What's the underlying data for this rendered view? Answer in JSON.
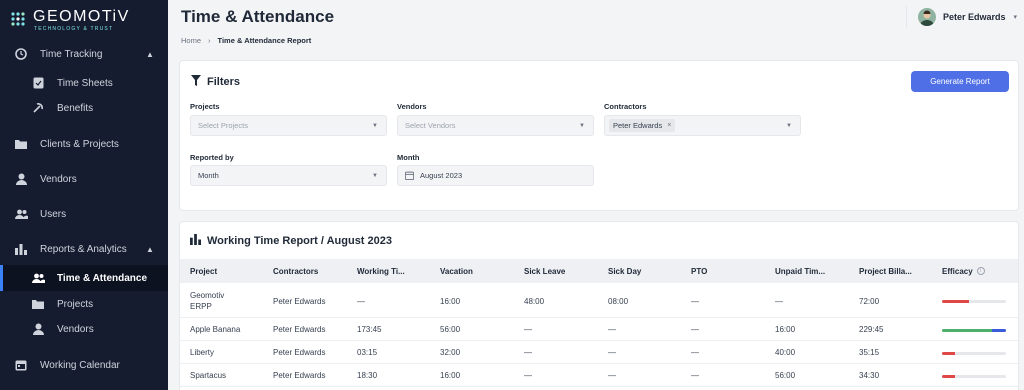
{
  "brand": {
    "name": "GEOMOTiV",
    "tagline": "TECHNOLOGY & TRUST"
  },
  "sidebar": {
    "items": [
      {
        "label": "Time Tracking",
        "icon": "clock-icon",
        "caret": "▲"
      },
      {
        "label": "Time Sheets",
        "icon": "timesheet-icon"
      },
      {
        "label": "Benefits",
        "icon": "benefits-icon"
      },
      {
        "label": "Clients & Projects",
        "icon": "folder-icon"
      },
      {
        "label": "Vendors",
        "icon": "user-icon"
      },
      {
        "label": "Users",
        "icon": "users-icon"
      },
      {
        "label": "Reports & Analytics",
        "icon": "bar-chart-icon",
        "caret": "▲"
      },
      {
        "label": "Time & Attendance",
        "icon": "users-icon"
      },
      {
        "label": "Projects",
        "icon": "folder-icon"
      },
      {
        "label": "Vendors",
        "icon": "user-icon"
      },
      {
        "label": "Working Calendar",
        "icon": "calendar-icon"
      }
    ]
  },
  "header": {
    "title": "Time & Attendance",
    "breadcrumb": {
      "home": "Home",
      "separator": "›",
      "current": "Time & Attendance Report"
    },
    "user": {
      "name": "Peter Edwards",
      "caret": "▾"
    }
  },
  "filters": {
    "title": "Filters",
    "generate_label": "Generate Report",
    "projects": {
      "label": "Projects",
      "placeholder": "Select Projects",
      "arrow": "▼"
    },
    "vendors": {
      "label": "Vendors",
      "placeholder": "Select Vendors",
      "arrow": "▼"
    },
    "contractors": {
      "label": "Contractors",
      "chip": "Peter Edwards",
      "chip_close": "×",
      "arrow": "▼"
    },
    "reported_by": {
      "label": "Reported by",
      "value": "Month",
      "arrow": "▼"
    },
    "month": {
      "label": "Month",
      "value": "August 2023"
    }
  },
  "report": {
    "title": "Working Time Report / August 2023",
    "columns": [
      "Project",
      "Contractors",
      "Working Ti...",
      "Vacation",
      "Sick Leave",
      "Sick Day",
      "PTO",
      "Unpaid Tim...",
      "Project Billa...",
      "Efficacy"
    ],
    "efficacy_info": "i",
    "rows": [
      {
        "project": "Geomotiv\nERPP",
        "contractor": "Peter Edwards",
        "working": "—",
        "vacation": "16:00",
        "sick_leave": "48:00",
        "sick_day": "08:00",
        "pto": "—",
        "unpaid": "—",
        "billable": "72:00",
        "efficacy": [
          {
            "fraction": 0.42,
            "color": "#e04848"
          }
        ]
      },
      {
        "project": "Apple Banana",
        "contractor": "Peter Edwards",
        "working": "173:45",
        "vacation": "56:00",
        "sick_leave": "—",
        "sick_day": "—",
        "pto": "—",
        "unpaid": "16:00",
        "billable": "229:45",
        "efficacy": [
          {
            "fraction": 0.78,
            "color": "#4caf6a"
          },
          {
            "fraction": 0.22,
            "color": "#3b5bdb"
          }
        ]
      },
      {
        "project": "Liberty",
        "contractor": "Peter Edwards",
        "working": "03:15",
        "vacation": "32:00",
        "sick_leave": "—",
        "sick_day": "—",
        "pto": "—",
        "unpaid": "40:00",
        "billable": "35:15",
        "efficacy": [
          {
            "fraction": 0.2,
            "color": "#e04848"
          }
        ]
      },
      {
        "project": "Spartacus",
        "contractor": "Peter Edwards",
        "working": "18:30",
        "vacation": "16:00",
        "sick_leave": "—",
        "sick_day": "—",
        "pto": "—",
        "unpaid": "56:00",
        "billable": "34:30",
        "efficacy": [
          {
            "fraction": 0.2,
            "color": "#e04848"
          }
        ]
      }
    ]
  },
  "colors": {
    "sidebar_bg": "#151c2f",
    "accent": "#4f6fe6",
    "brand_teal": "#7ee3e6"
  }
}
